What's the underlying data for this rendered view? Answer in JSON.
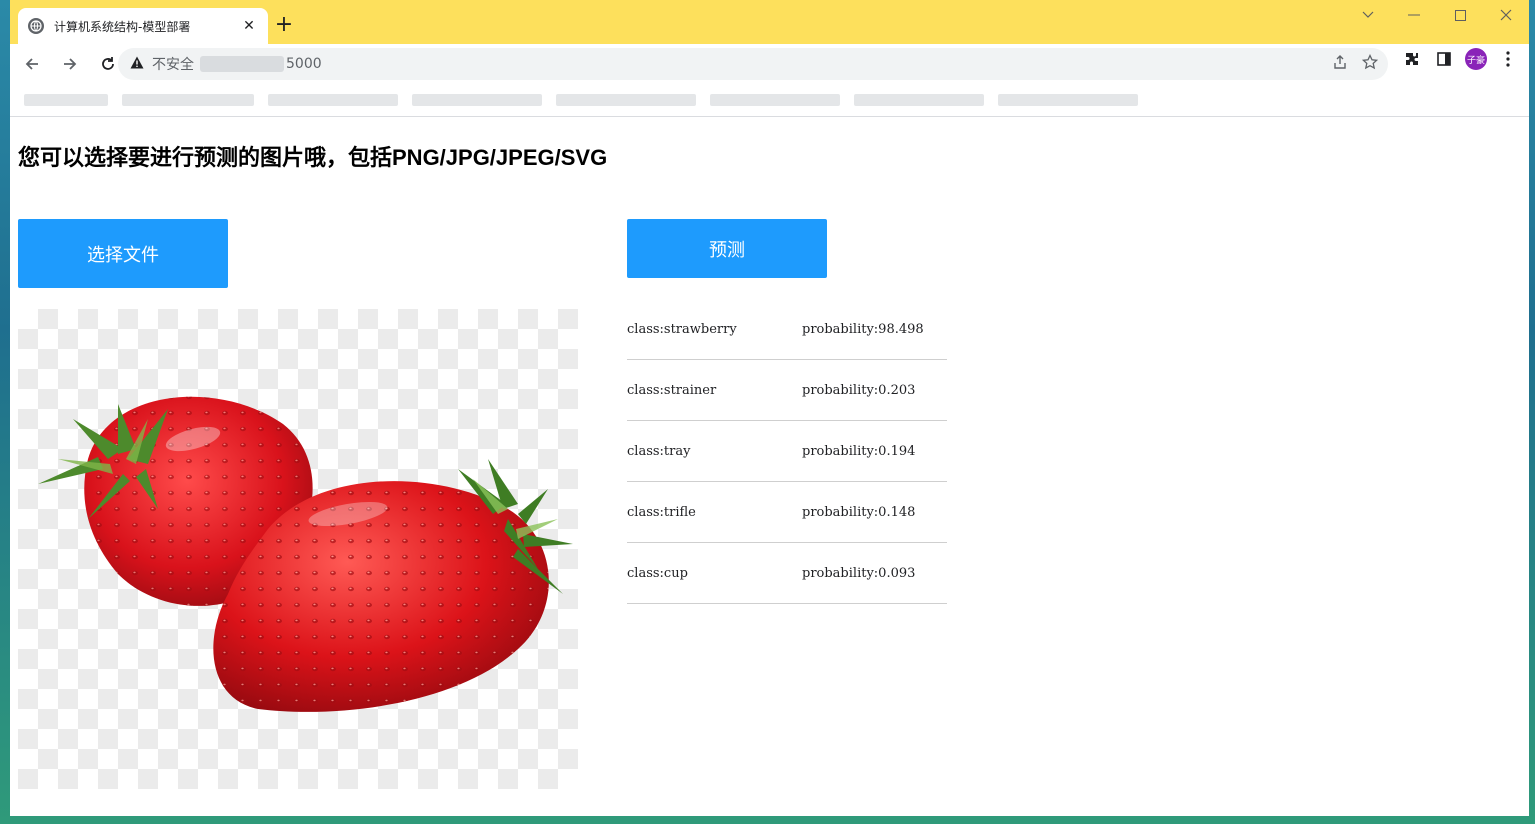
{
  "browser": {
    "tab_title": "计算机系统结构-模型部署",
    "tab_close": "✕",
    "new_tab": "+",
    "security_label": "不安全",
    "url_visible": "5000",
    "profile_initials": "子豪"
  },
  "page": {
    "heading": "您可以选择要进行预测的图片哦，包括PNG/JPG/JPEG/SVG",
    "file_button_label": "选择文件",
    "predict_button_label": "预测",
    "results": [
      {
        "class": "class:strawberry",
        "probability": "probability:98.498"
      },
      {
        "class": "class:strainer",
        "probability": "probability:0.203"
      },
      {
        "class": "class:tray",
        "probability": "probability:0.194"
      },
      {
        "class": "class:trifle",
        "probability": "probability:0.148"
      },
      {
        "class": "class:cup",
        "probability": "probability:0.093"
      }
    ]
  },
  "colors": {
    "tabstrip": "#fde05c",
    "button": "#1e9bfd",
    "strawberry": "#d7141d"
  }
}
